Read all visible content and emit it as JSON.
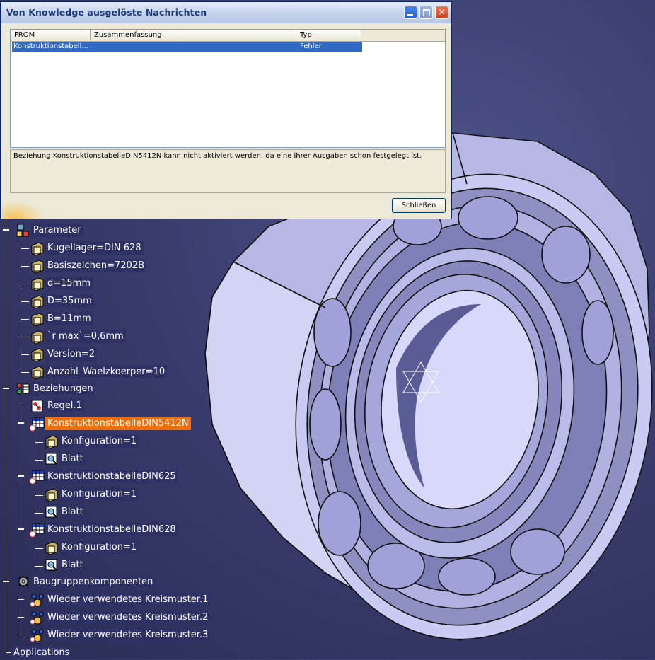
{
  "dialog": {
    "title": "Von Knowledge ausgelöste Nachrichten",
    "columns": [
      "FROM",
      "Zusammenfassung",
      "Typ"
    ],
    "rows": [
      {
        "from": "Konstruktionstabell…",
        "summary": "",
        "type": "Fehler"
      }
    ],
    "message": "Beziehung KonstruktionstabelleDIN5412N kann nicht aktiviert werden, da eine ihrer Ausgaben schon festgelegt ist.",
    "close_label": "Schließen"
  },
  "tree": {
    "parameter": {
      "label": "Parameter",
      "items": [
        "Kugellager=DIN 628",
        "Basiszeichen=7202B",
        "d=15mm",
        "D=35mm",
        "B=11mm",
        "`r max`=0,6mm",
        "Version=2",
        "Anzahl_Waelzkoerper=10"
      ]
    },
    "beziehungen": {
      "label": "Beziehungen",
      "regel": "Regel.1",
      "tables": [
        {
          "label": "KonstruktionstabelleDIN5412N",
          "children": [
            "Konfiguration=1",
            "Blatt"
          ]
        },
        {
          "label": "KonstruktionstabelleDIN625",
          "children": [
            "Konfiguration=1",
            "Blatt"
          ]
        },
        {
          "label": "KonstruktionstabelleDIN628",
          "children": [
            "Konfiguration=1",
            "Blatt"
          ]
        }
      ]
    },
    "baugruppen": {
      "label": "Baugruppenkomponenten",
      "items": [
        "Wieder verwendetes Kreismuster.1",
        "Wieder verwendetes Kreismuster.2",
        "Wieder verwendetes Kreismuster.3"
      ]
    },
    "applications": "Applications"
  },
  "colors": {
    "background": "#3a3d6e",
    "selection": "#f06d0a",
    "bearing_face": "#c4c5ee"
  }
}
